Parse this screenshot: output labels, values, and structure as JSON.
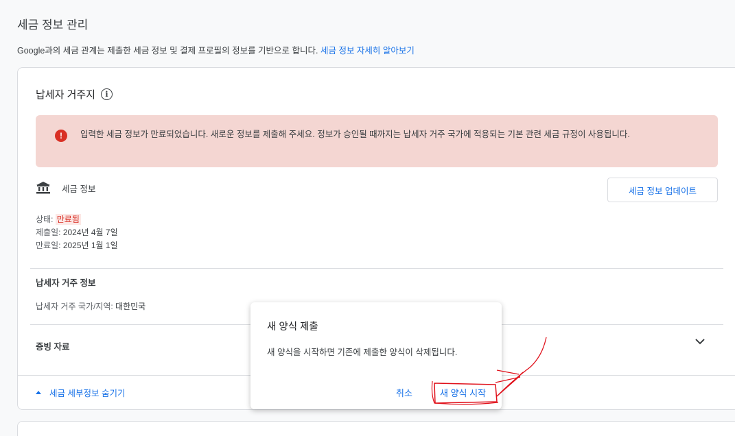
{
  "header": {
    "title": "세금 정보 관리",
    "description": "Google과의 세금 관계는 제출한 세금 정보 및 결제 프로필의 정보를 기반으로 합니다.",
    "learn_more": "세금 정보 자세히 알아보기"
  },
  "card": {
    "section_title": "납세자 거주지",
    "alert_text": "입력한 세금 정보가 만료되었습니다. 새로운 정보를 제출해 주세요. 정보가 승인될 때까지는 납세자 거주 국가에 적용되는 기본 관련 세금 규정이 사용됩니다.",
    "tax_info_label": "세금 정보",
    "update_button": "세금 정보 업데이트",
    "status_label": "상태:",
    "status_value": "만료됨",
    "submitted_label": "제출일:",
    "submitted_value": "2024년 4월 7일",
    "expires_label": "만료일:",
    "expires_value": "2025년 1월 1일",
    "residence_heading": "납세자 거주 정보",
    "residence_label": "납세자 거주 국가/지역:",
    "residence_value": "대한민국",
    "proof_heading": "증빙 자료",
    "hide_details": "세금 세부정보 숨기기"
  },
  "dialog": {
    "title": "새 양식 제출",
    "body": "새 양식을 시작하면 기존에 제출한 양식이 삭제됩니다.",
    "cancel": "취소",
    "start": "새 양식 시작"
  },
  "colors": {
    "accent": "#1a73e8",
    "error": "#d93025",
    "alert_bg": "#f4d6d2",
    "annotation": "#e0101a"
  }
}
